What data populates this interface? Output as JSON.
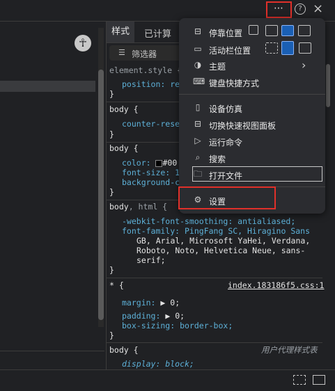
{
  "topbar": {
    "more_label": "⋯",
    "help_icon": "help-icon",
    "close_icon": "close-icon"
  },
  "styles_pane": {
    "tabs": [
      {
        "label": "样式"
      },
      {
        "label": "已计算"
      }
    ],
    "filter_placeholder": "筛选器",
    "rules": [
      {
        "selector": "element.style {",
        "decls": [
          "position: re"
        ],
        "close": "}"
      },
      {
        "selector": "body {",
        "decls": [
          "counter-rese"
        ],
        "close": "}"
      },
      {
        "selector": "body {",
        "decls": [
          "color:",
          "#00",
          "font-size: 1",
          "background-co"
        ],
        "close": "}"
      },
      {
        "selector": "body",
        "selector_extra": ", html {",
        "decls": [
          "-webkit-font-smoothing: antialiased;",
          "font-family: PingFang SC, Hiragino Sans",
          "GB, Arial, Microsoft YaHei, Verdana,",
          "Roboto, Noto, Helvetica Neue, sans-",
          "serif;"
        ],
        "close": "}"
      },
      {
        "selector": "* {",
        "source": "index.183186f5.css:1",
        "decls": [
          "margin:",
          "▶",
          "0;",
          "padding:",
          "▶",
          "0;",
          "box-sizing: border-box;"
        ],
        "close": "}"
      },
      {
        "selector": "body {",
        "source": "用户代理样式表",
        "decls": [
          "display: block;"
        ]
      }
    ]
  },
  "menu": {
    "items": [
      {
        "icon": "dock-side-icon",
        "label": "停靠位置"
      },
      {
        "icon": "activity-bar-icon",
        "label": "活动栏位置"
      },
      {
        "icon": "theme-icon",
        "label": "主题",
        "chevron": "›"
      },
      {
        "icon": "keyboard-icon",
        "label": "键盘快捷方式"
      },
      {
        "icon": "device-emulation-icon",
        "label": "设备仿真"
      },
      {
        "icon": "quick-view-icon",
        "label": "切换快速视图面板"
      },
      {
        "icon": "run-command-icon",
        "label": "运行命令"
      },
      {
        "icon": "search-icon",
        "label": "搜索"
      },
      {
        "icon": "folder-icon",
        "label": "打开文件"
      },
      {
        "icon": "gear-icon",
        "label": "设置"
      }
    ],
    "dock_options": [
      "undock",
      "dock-left",
      "dock-bottom",
      "dock-right"
    ],
    "dock_selected": "dock-bottom",
    "activity_options": [
      "hidden",
      "top",
      "left"
    ],
    "activity_selected": "top"
  },
  "colors": {
    "background": "#202124",
    "menu_bg": "#2b2c30",
    "highlight_red": "#e0302a",
    "property_blue": "#5db0d7",
    "active_blue": "#1a5fb4"
  }
}
